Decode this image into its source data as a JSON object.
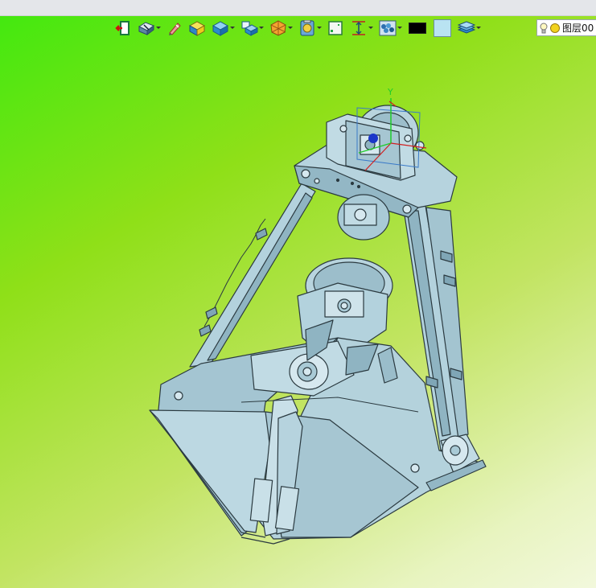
{
  "toolbar": {
    "buttons": [
      {
        "icon": "exit-icon",
        "menu": false
      },
      {
        "icon": "sketch-icon",
        "menu": true
      },
      {
        "icon": "pencil-icon",
        "menu": false
      },
      {
        "icon": "solid-face-icon",
        "menu": false
      },
      {
        "icon": "cube-icon",
        "menu": true
      },
      {
        "icon": "view-cube-icon",
        "menu": true
      },
      {
        "icon": "render-mode-icon",
        "menu": true
      },
      {
        "icon": "clipboard-icon",
        "menu": true
      },
      {
        "icon": "green-frame-icon",
        "menu": false
      },
      {
        "icon": "dimension-icon",
        "menu": true
      },
      {
        "icon": "material-icon",
        "menu": true
      }
    ],
    "color_swatch": "#000000",
    "bg_swatch": "#b9e3f2"
  },
  "layer": {
    "label": "图层00"
  },
  "colors": {
    "part": "#a9cad6",
    "edge": "#2b3a40",
    "background_top": "#3fe90f",
    "background_bottom": "#f2f8dc"
  }
}
